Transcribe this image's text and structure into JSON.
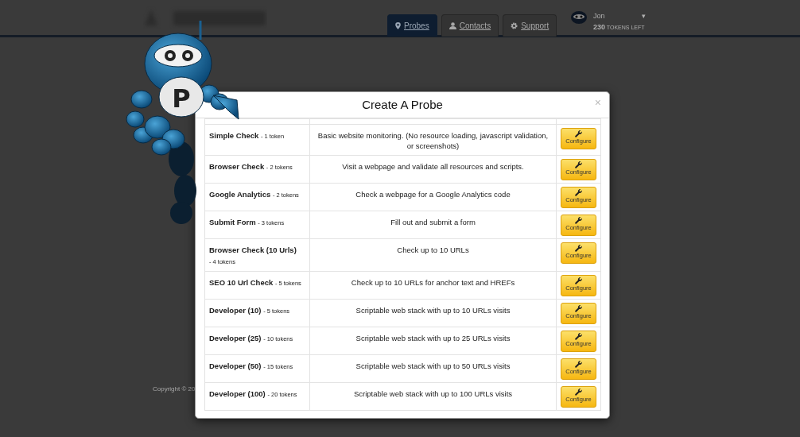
{
  "header": {
    "tabs": [
      {
        "label": "Probes",
        "selected": true
      },
      {
        "label": "Contacts",
        "selected": false
      },
      {
        "label": "Support",
        "selected": false
      }
    ],
    "user": {
      "name": "Jon",
      "menu_caret": "▾",
      "tokens": "230",
      "tokens_label": "TOKENS LEFT"
    }
  },
  "mascot": {
    "letter": "P"
  },
  "footer": {
    "copyright": "Copyright © 20"
  },
  "modal": {
    "title": "Create A Probe",
    "close": "×",
    "probes": [
      {
        "name": "Simple Check",
        "cost": "- 1 token",
        "description": "Basic website monitoring. (No resource loading, javascript validation, or screenshots)",
        "button": "Configure"
      },
      {
        "name": "Browser Check",
        "cost": "- 2 tokens",
        "description": "Visit a webpage and validate all resources and scripts.",
        "button": "Configure"
      },
      {
        "name": "Google Analytics",
        "cost": "- 2 tokens",
        "description": "Check a webpage for a Google Analytics code",
        "button": "Configure"
      },
      {
        "name": "Submit Form",
        "cost": "- 3 tokens",
        "description": "Fill out and submit a form",
        "button": "Configure"
      },
      {
        "name": "Browser Check (10 Urls)",
        "cost": "- 4 tokens",
        "description": "Check up to 10 URLs",
        "button": "Configure"
      },
      {
        "name": "SEO 10 Url Check",
        "cost": "- 5 tokens",
        "description": "Check up to 10 URLs for anchor text and HREFs",
        "button": "Configure"
      },
      {
        "name": "Developer (10)",
        "cost": "- 5 tokens",
        "description": "Scriptable web stack with up to 10 URLs visits",
        "button": "Configure"
      },
      {
        "name": "Developer (25)",
        "cost": "- 10 tokens",
        "description": "Scriptable web stack with up to 25 URLs visits",
        "button": "Configure"
      },
      {
        "name": "Developer (50)",
        "cost": "- 15 tokens",
        "description": "Scriptable web stack with up to 50 URLs visits",
        "button": "Configure"
      },
      {
        "name": "Developer (100)",
        "cost": "- 20 tokens",
        "description": "Scriptable web stack with up to 100 URLs visits",
        "button": "Configure"
      }
    ]
  }
}
